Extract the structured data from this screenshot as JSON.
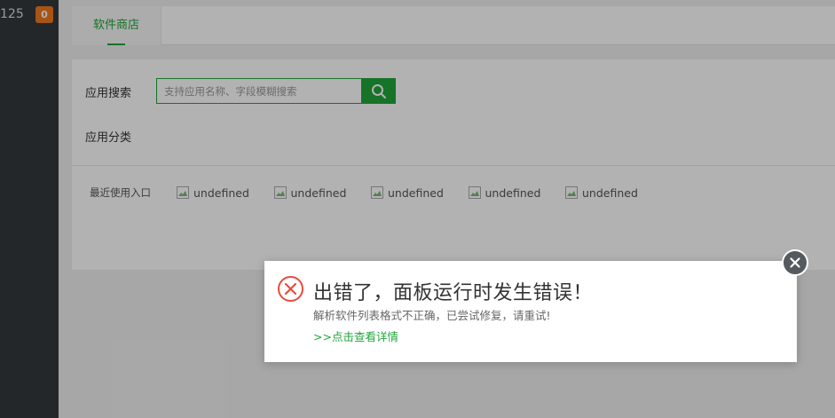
{
  "sidebar": {
    "count_text": "125",
    "badge": "0",
    "badge_color": "#f0791e"
  },
  "tabs": [
    {
      "label": "软件商店",
      "active": true
    }
  ],
  "search": {
    "label": "应用搜索",
    "placeholder": "支持应用名称、字段模糊搜索",
    "button_icon": "search-icon"
  },
  "category": {
    "label": "应用分类"
  },
  "recent": {
    "label": "最近使用入口",
    "items": [
      "undefined",
      "undefined",
      "undefined",
      "undefined",
      "undefined"
    ]
  },
  "dialog": {
    "icon": "error-circle-icon",
    "title": "出错了，面板运行时发生错误！",
    "message": "解析软件列表格式不正确，已尝试修复，请重试!",
    "link": ">>点击查看详情",
    "close_icon": "close-icon"
  },
  "colors": {
    "accent": "#20a53a",
    "error": "#e74c3c",
    "sidebar_bg": "#33383d"
  }
}
